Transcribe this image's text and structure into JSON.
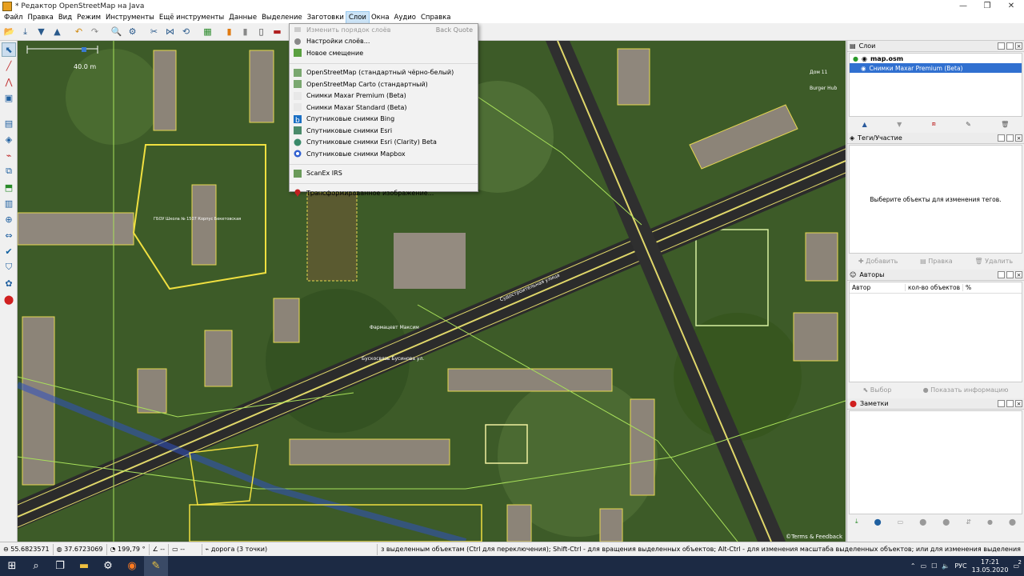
{
  "window": {
    "title": "* Редактор OpenStreetMap на Java",
    "min": "—",
    "max": "❐",
    "close": "✕"
  },
  "menu": [
    "Файл",
    "Правка",
    "Вид",
    "Режим",
    "Инструменты",
    "Ещё инструменты",
    "Данные",
    "Выделение",
    "Заготовки",
    "Слои",
    "Окна",
    "Аудио",
    "Справка"
  ],
  "active_menu": "Слои",
  "dropdown": {
    "change_order": "Изменить порядок слоёв",
    "change_order_shortcut": "Back Quote",
    "layer_settings": "Настройки слоёв...",
    "new_offset": "Новое смещение",
    "osm_standard_bw": "OpenStreetMap (стандартный чёрно-белый)",
    "osm_carto": "OpenStreetMap Carto (стандартный)",
    "maxar_premium": "Снимки Maxar Premium (Beta)",
    "maxar_standard": "Снимки Maxar Standard (Beta)",
    "bing": "Спутниковые снимки Bing",
    "esri": "Спутниковые снимки Esri",
    "esri_clarity": "Спутниковые снимки Esri (Clarity) Beta",
    "mapbox": "Спутниковые снимки Mapbox",
    "scanex": "ScanEx IRS",
    "transformed": "Трансформированное изображение..."
  },
  "map": {
    "scale": "40.0 m",
    "credit": "©Terms & Feedback",
    "labels": {
      "school": "ГБОУ Школа № 1507 Корпус Бекетовская",
      "pharmacy": "Фармацевт Максим",
      "bus_stop": "Бускосвязь Бусинова ул.",
      "street": "Судостроительная улица",
      "burger": "Burger Hub",
      "house": "Дом 11"
    }
  },
  "layers_panel": {
    "title": "Слои",
    "items": [
      {
        "name": "map.osm",
        "active": true
      },
      {
        "name": "Снимки Maxar Premium (Beta)",
        "selected": true
      }
    ]
  },
  "tags_panel": {
    "title": "Теги/Участие",
    "empty": "Выберите объекты для изменения тегов.",
    "add": "Добавить",
    "edit": "Правка",
    "delete": "Удалить"
  },
  "authors_panel": {
    "title": "Авторы",
    "col_author": "Автор",
    "col_count": "кол-во объектов",
    "col_pct": "%",
    "select": "Выбор",
    "info": "Показать информацию"
  },
  "notes_panel": {
    "title": "Заметки"
  },
  "status": {
    "lat": "55.6823571",
    "lon": "37.6723069",
    "heading": "199,79 °",
    "angle": "--",
    "length": "--",
    "way": "дорога (3 точки)",
    "hint": "з выделенным объектам (Ctrl для переключения); Shift-Ctrl - для вращения выделенных объектов; Alt-Ctrl - для изменения масштаба выделенных объектов; или для изменения выделения"
  },
  "taskbar": {
    "lang": "РУС",
    "time": "17:21",
    "date": "13.05.2020",
    "badge": "2"
  },
  "colors": {
    "map_bg": "#3f5a2c",
    "road": "#e0d76a",
    "way": "#a8e05a",
    "selection": "#cce4f7"
  }
}
